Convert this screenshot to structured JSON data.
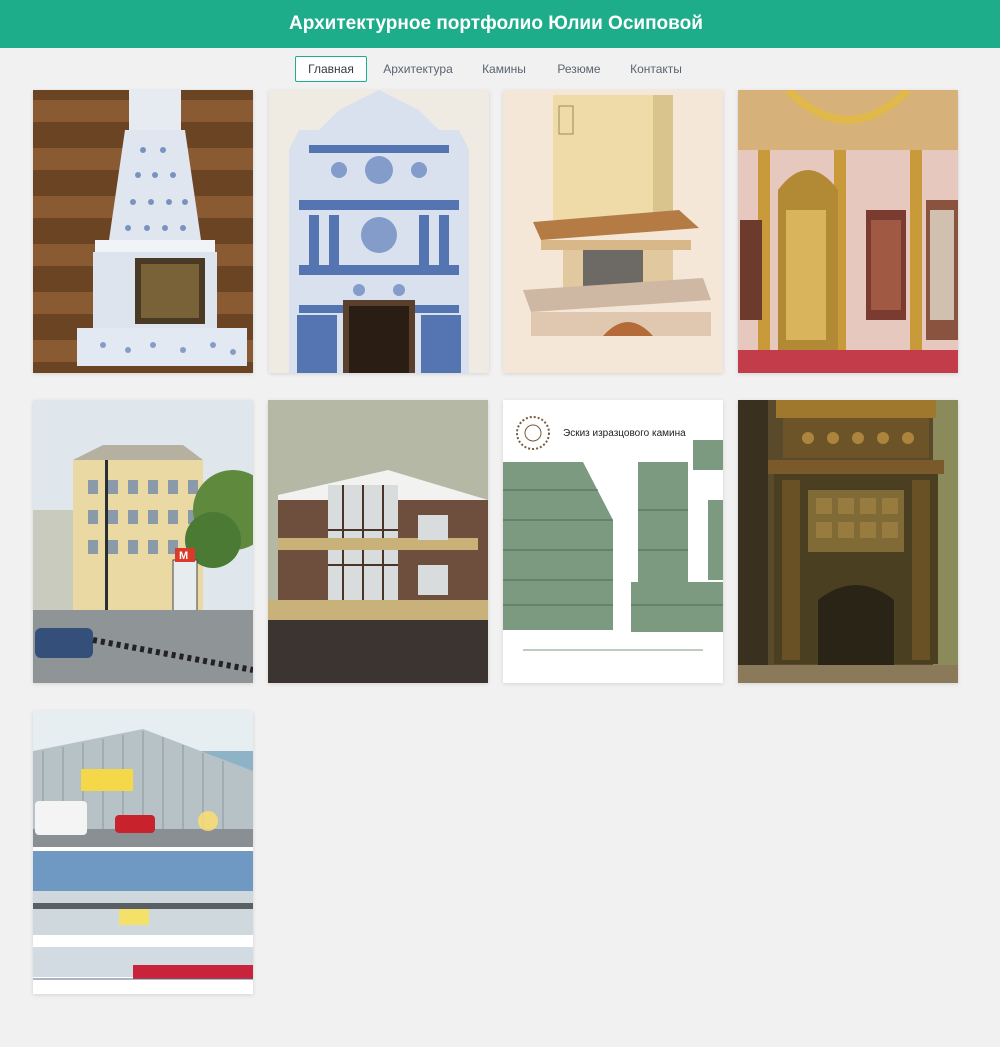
{
  "header": {
    "title": "Архитектурное портфолио Юлии Осиповой"
  },
  "nav": {
    "items": [
      {
        "label": "Главная",
        "active": true
      },
      {
        "label": "Архитектура",
        "active": false
      },
      {
        "label": "Камины",
        "active": false
      },
      {
        "label": "Резюме",
        "active": false
      },
      {
        "label": "Контакты",
        "active": false
      }
    ]
  },
  "gallery": {
    "items": [
      {
        "subject": "blue-white tiled fireplace in log interior"
      },
      {
        "subject": "ornate blue-white tiled stove"
      },
      {
        "subject": "watercolor sketch of stone fireplace"
      },
      {
        "subject": "gilded church iconostasis"
      },
      {
        "subject": "city street with yellow building and metro sign",
        "metro_sign": "М"
      },
      {
        "subject": "3D render of brick house with large windows"
      },
      {
        "subject": "drawing of tiled fireplace",
        "caption": "Эскиз изразцового камина"
      },
      {
        "subject": "dark ornate carved tiled fireplace"
      },
      {
        "subject": "shopping center renders with facade elevations"
      }
    ]
  },
  "colors": {
    "header_bg": "#1ead8a",
    "page_bg": "#f1f1f1",
    "nav_active_border": "#1ead8a"
  }
}
